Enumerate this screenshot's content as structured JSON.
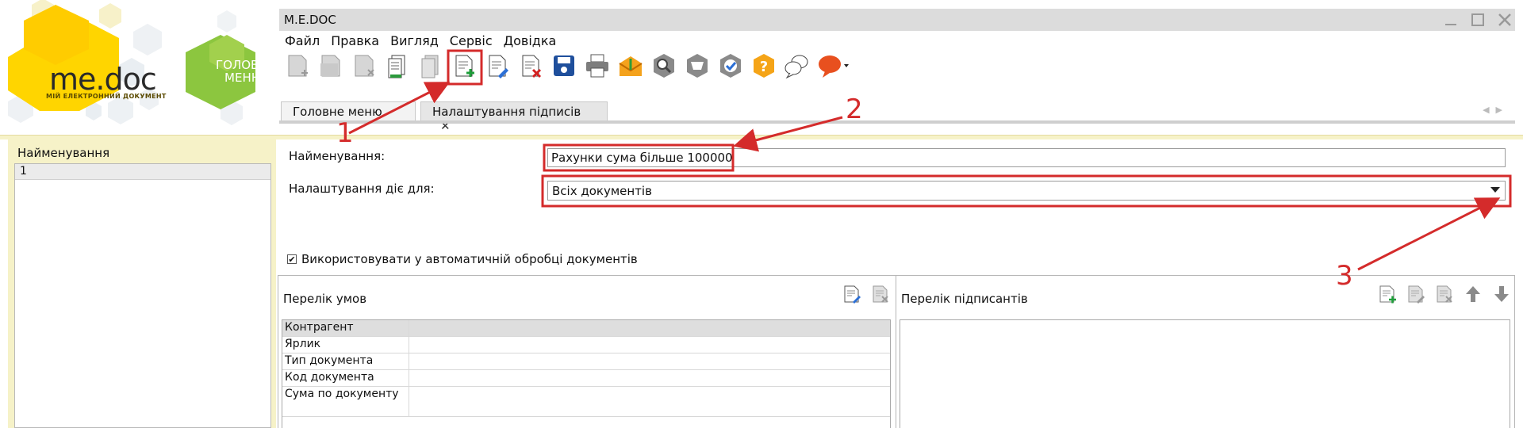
{
  "logo": {
    "brand": "me.doc",
    "tagline": "МІЙ ЕЛЕКТРОННИЙ ДОКУМЕНТ",
    "main_menu_label": "ГОЛОВНЕ МЕНЮ"
  },
  "window": {
    "title": "M.E.DOC"
  },
  "menu": [
    "Файл",
    "Правка",
    "Вигляд",
    "Сервіс",
    "Довідка"
  ],
  "toolbar": {
    "icons": [
      "new-doc-icon",
      "open-doc-icon",
      "delete-doc-icon",
      "copy-doc-icon",
      "duplicate-doc-icon",
      "add-setting-icon",
      "edit-setting-icon",
      "remove-setting-icon",
      "save-icon",
      "print-icon",
      "send-icon",
      "search-icon",
      "archive-icon",
      "check-icon",
      "help-icon",
      "chat-icon",
      "feedback-icon"
    ]
  },
  "tabs": [
    {
      "label": "Головне меню"
    },
    {
      "label": "Налаштування підписів",
      "close": "✕"
    }
  ],
  "side_panel": {
    "header": "Найменування",
    "rows": [
      "1"
    ]
  },
  "form": {
    "name_label": "Найменування:",
    "name_value": "Рахунки сума більше 100000",
    "scope_label": "Налаштування діє для:",
    "scope_value": "Всіх документів",
    "auto_label": "Використовувати у автоматичній обробці документів",
    "auto_checked": "✔"
  },
  "conditions": {
    "title": "Перелік умов",
    "rows": [
      "Контрагент",
      "Ярлик",
      "Тип документа",
      "Код документа",
      "Сума по документу"
    ]
  },
  "signers": {
    "title": "Перелік підписантів"
  },
  "annotations": {
    "n1": "1",
    "n2": "2",
    "n3": "3",
    "color": "#d42b2b"
  },
  "colors": {
    "logo_yellow": "#ffd500",
    "menu_green": "#8cc63f",
    "panel_bg": "#f6f2c8",
    "annotation_red": "#d42b2b"
  }
}
